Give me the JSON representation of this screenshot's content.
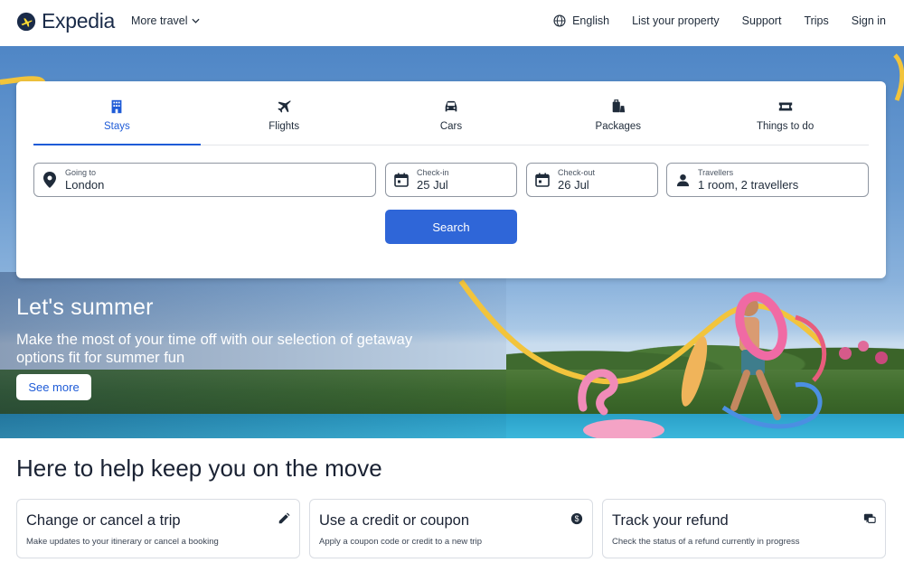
{
  "header": {
    "logo_text": "Expedia",
    "more_travel": "More travel",
    "language": "English",
    "list_property": "List your property",
    "support": "Support",
    "trips": "Trips",
    "sign_in": "Sign in"
  },
  "search": {
    "tabs": [
      {
        "label": "Stays",
        "icon": "building-icon",
        "active": true
      },
      {
        "label": "Flights",
        "icon": "plane-icon",
        "active": false
      },
      {
        "label": "Cars",
        "icon": "car-icon",
        "active": false
      },
      {
        "label": "Packages",
        "icon": "suitcase-icon",
        "active": false
      },
      {
        "label": "Things to do",
        "icon": "ticket-icon",
        "active": false
      }
    ],
    "going_to": {
      "label": "Going to",
      "value": "London"
    },
    "check_in": {
      "label": "Check-in",
      "value": "25 Jul"
    },
    "check_out": {
      "label": "Check-out",
      "value": "26 Jul"
    },
    "travellers": {
      "label": "Travellers",
      "value": "1 room, 2 travellers"
    },
    "button": "Search"
  },
  "hero": {
    "title": "Let's summer",
    "subtitle": "Make the most of your time off with our selection of getaway options fit for summer fun",
    "button": "See more"
  },
  "help": {
    "title": "Here to help keep you on the move",
    "cards": [
      {
        "title": "Change or cancel a trip",
        "desc": "Make updates to your itinerary or cancel a booking",
        "icon": "pencil-icon"
      },
      {
        "title": "Use a credit or coupon",
        "desc": "Apply a coupon code or credit to a new trip",
        "icon": "coin-icon"
      },
      {
        "title": "Track your refund",
        "desc": "Check the status of a refund currently in progress",
        "icon": "chat-icon"
      }
    ]
  },
  "colors": {
    "brand_blue": "#1e5bd7",
    "button_blue": "#2f66d8",
    "logo_yellow": "#fddb32",
    "navy": "#1a2b49"
  }
}
